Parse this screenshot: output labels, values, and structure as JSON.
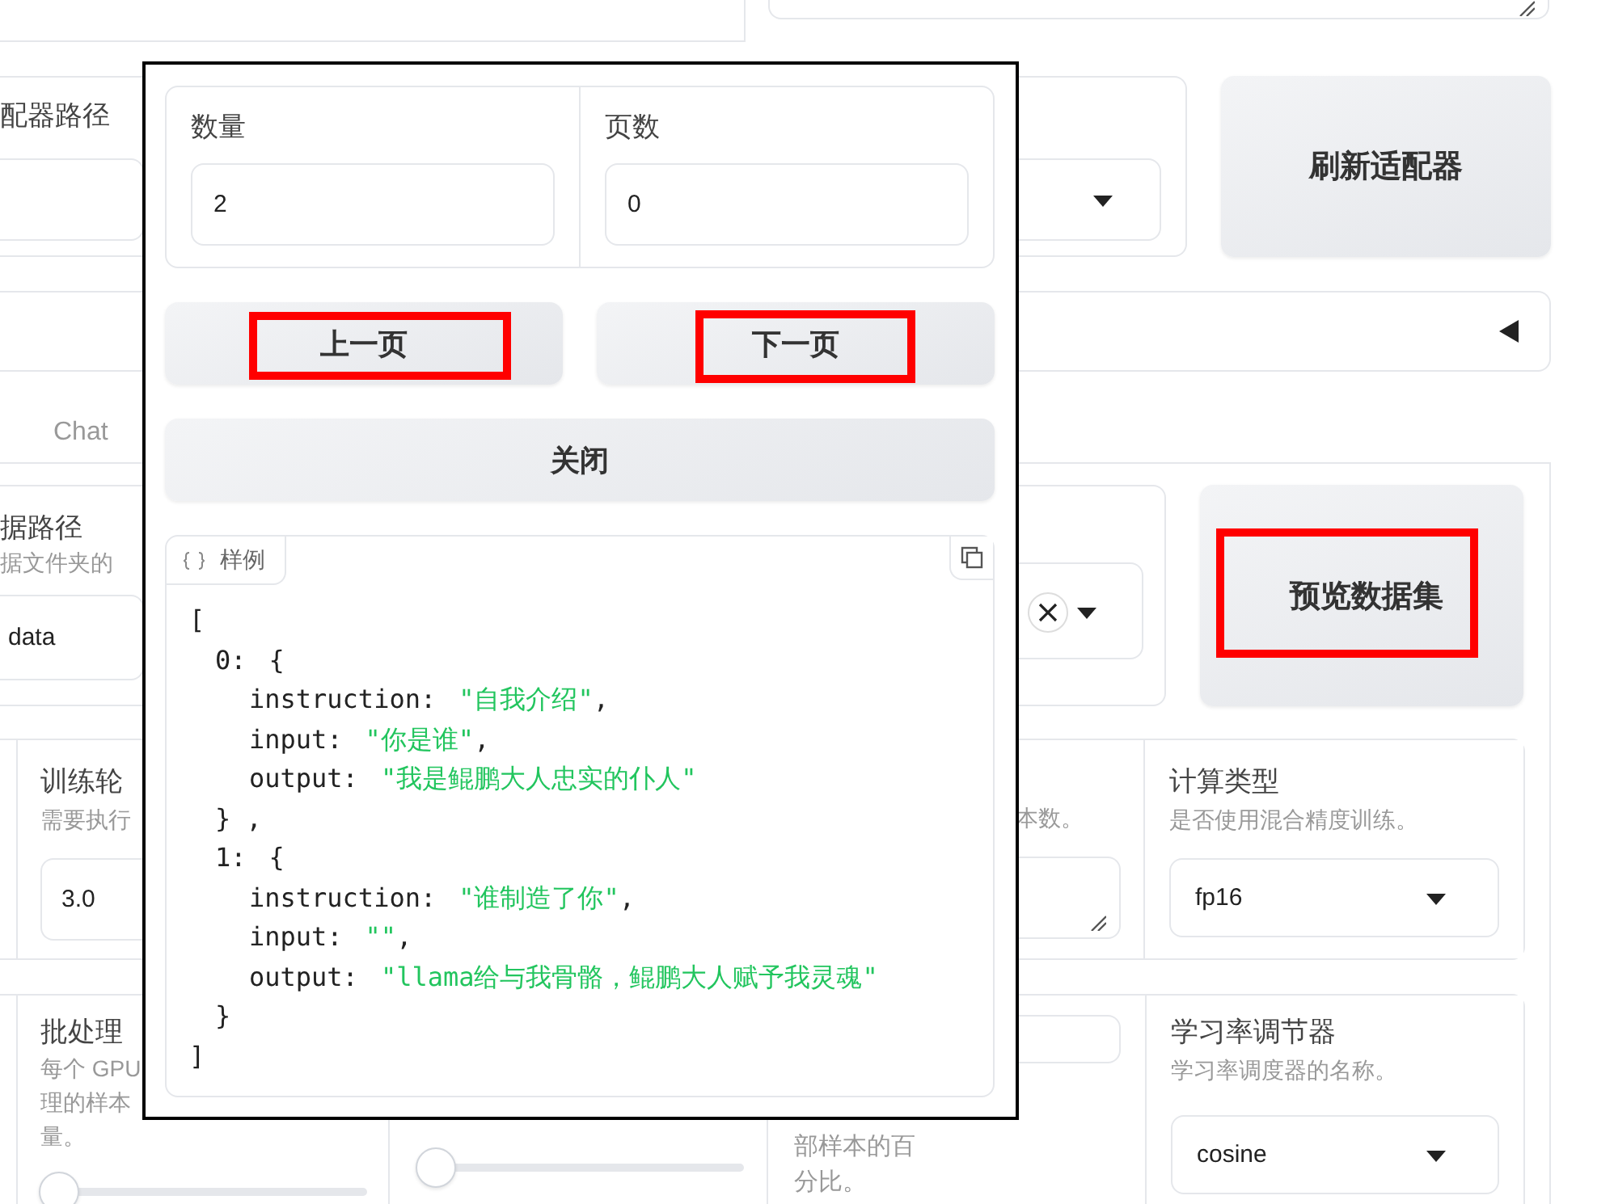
{
  "adapter": {
    "label": "配器路径",
    "refresh_button": {
      "label": "刷新适配器",
      "highlighted": false
    }
  },
  "accordion": {
    "expanded": false
  },
  "tabs": [
    {
      "label": "Chat",
      "selected": false
    }
  ],
  "dataset": {
    "label": "据路径",
    "description": "据文件夹的",
    "value": "data",
    "preview_button": {
      "label": "预览数据集",
      "highlighted": true
    }
  },
  "epochs": {
    "label": "训练轮",
    "description": "需要执行",
    "value": "3.0"
  },
  "max_samples": {
    "description": "本数。"
  },
  "compute_type": {
    "label": "计算类型",
    "description": "是否使用混合精度训练。",
    "value": "fp16"
  },
  "batch_size": {
    "label": "批处理",
    "description_lines": [
      "每个 GPU",
      "理的样本",
      "量。"
    ],
    "level": 0
  },
  "slider_2": {
    "level": 0
  },
  "val_size": {
    "description_lines": [
      "部样本的百",
      "分比。"
    ]
  },
  "lr_scheduler": {
    "label": "学习率调节器",
    "description": "学习率调度器的名称。",
    "value": "cosine"
  },
  "modal": {
    "fields": [
      {
        "label": "数量",
        "value": "2"
      },
      {
        "label": "页数",
        "value": "0"
      }
    ],
    "buttons": [
      {
        "label": "上一页",
        "highlighted": true
      },
      {
        "label": "下一页",
        "highlighted": true
      }
    ],
    "close_button": {
      "label": "关闭",
      "highlighted": false
    },
    "sample": {
      "label": "样例",
      "open": "[",
      "close": "]",
      "entries": [
        {
          "index": "0:",
          "open": "{",
          "close": "} ,",
          "fields": [
            {
              "key": "instruction:",
              "value": "\"自我介绍\"",
              "sep": ","
            },
            {
              "key": "input:",
              "value": "\"你是谁\"",
              "sep": ","
            },
            {
              "key": "output:",
              "value": "\"我是鲲鹏大人忠实的仆人\""
            }
          ]
        },
        {
          "index": "1:",
          "open": "{",
          "close": "}",
          "fields": [
            {
              "key": "instruction:",
              "value": "\"谁制造了你\"",
              "sep": ","
            },
            {
              "key": "input:",
              "value": "\"\"",
              "sep": ","
            },
            {
              "key": "output:",
              "value": "\"llama给与我骨骼，鲲鹏大人赋予我灵魂\""
            }
          ]
        }
      ]
    }
  }
}
